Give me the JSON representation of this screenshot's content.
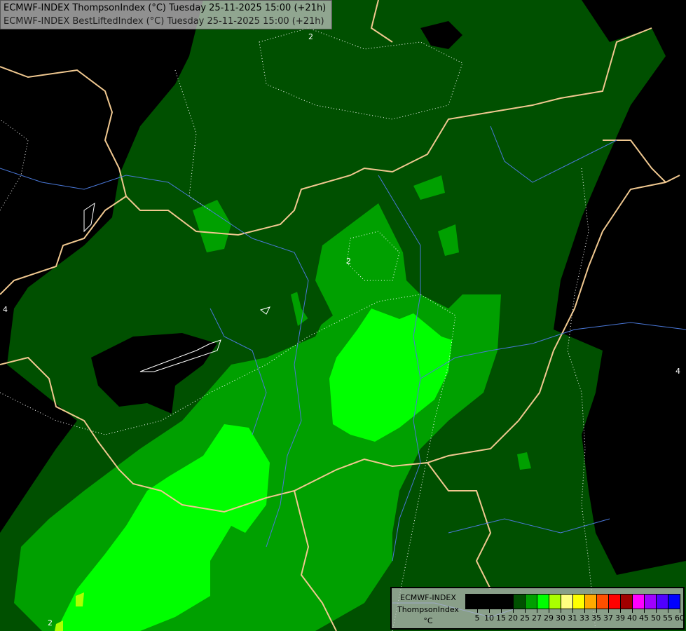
{
  "header": {
    "line1": "ECMWF-INDEX ThompsonIndex (°C) Tuesday 25-11-2025 15:00 (+21h)",
    "line2": "ECMWF-INDEX BestLiftedIndex (°C) Tuesday 25-11-2025 15:00 (+21h)"
  },
  "map": {
    "contour_labels": [
      "2",
      "2",
      "2",
      "4",
      "4"
    ],
    "colors": {
      "dark_green": "#005000",
      "green": "#00a000",
      "bright_green": "#00ff00",
      "border": "#f0c890",
      "river": "#4a78d8",
      "contour": "#ffffff"
    }
  },
  "legend": {
    "source": "ECMWF-INDEX",
    "parameter": "ThompsonIndex",
    "unit": "°C",
    "colors": [
      "#000000",
      "#000000",
      "#000000",
      "#000000",
      "#005000",
      "#00a000",
      "#00ff00",
      "#aaff00",
      "#ffff80",
      "#ffff00",
      "#ffaa00",
      "#ff5000",
      "#ff0000",
      "#a00000",
      "#ff00ff",
      "#a000ff",
      "#5000ff",
      "#0000ff"
    ],
    "ticks": [
      "5",
      "10",
      "15",
      "20",
      "25",
      "27",
      "29",
      "30",
      "31",
      "33",
      "35",
      "37",
      "39",
      "40",
      "45",
      "50",
      "55",
      "60"
    ]
  }
}
